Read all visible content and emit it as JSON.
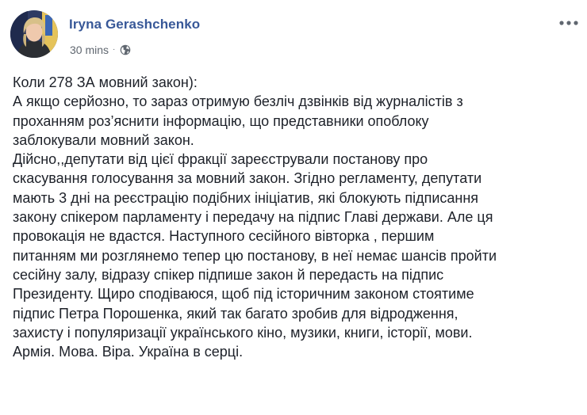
{
  "post": {
    "author": "Iryna Gerashchenko",
    "timestamp": "30 mins",
    "separator": "·",
    "audience_icon": "globe-icon",
    "menu_icon": "more-options-icon",
    "avatar_icon": "profile-avatar",
    "colors": {
      "author_link": "#385898",
      "text": "#1d2129",
      "meta": "#606770"
    },
    "lines": [
      "Коли 278 ЗА мовний закон):",
      "А якщо серйозно, то зараз отримую безліч дзвінків від журналістів з",
      "проханням роз’яснити інформацію, що представники опоблоку",
      "заблокували мовний закон.",
      "Дійсно,,депутати від цієї фракції зареєстрували постанову про",
      "скасування голосування за мовний закон. Згідно регламенту, депутати",
      "мають 3 дні на реєстрацію подібних ініціатив, які блокують підписання",
      "закону спікером парламенту і передачу на підпис Главі держави. Але ця",
      "провокація не вдастся. Наступного сесійного вівторка , першим",
      "питанням ми розглянемо тепер цю постанову, в неї немає шансів пройти",
      "сесійну залу, відразу спікер підпише закон й передасть на підпис",
      "Президенту. Щиро сподіваюся, щоб під історичним законом стоятиме",
      "підпис Петра Порошенка, який так багато зробив для відродження,",
      "захисту і популяризації українського кіно, музики, книги, історії, мови.",
      "Армія. Мова. Віра. Україна в серці."
    ]
  }
}
